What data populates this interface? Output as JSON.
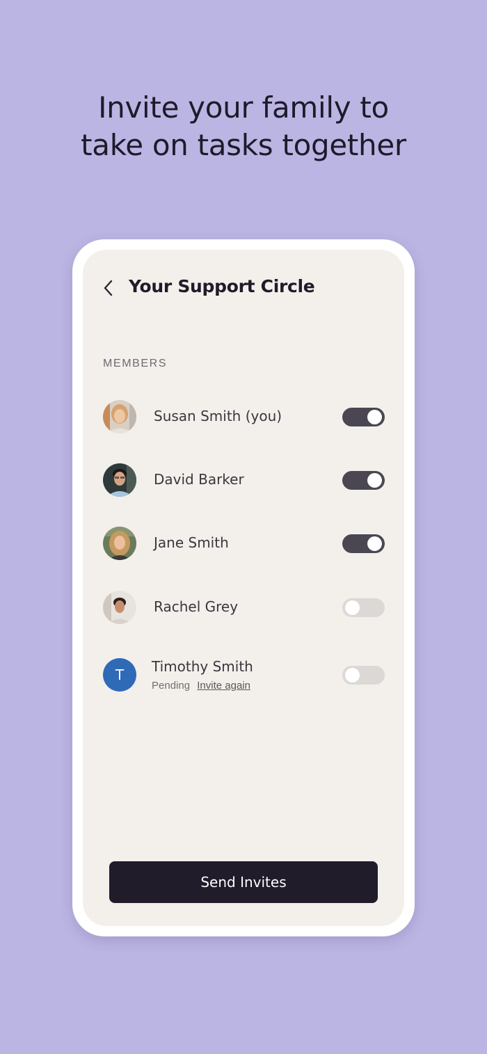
{
  "headline": {
    "line1": "Invite your family to",
    "line2": "take on tasks together"
  },
  "screen": {
    "title": "Your Support Circle",
    "back_icon": "chevron-left-icon"
  },
  "members_section": {
    "label": "MEMBERS",
    "members": [
      {
        "name": "Susan Smith (you)",
        "avatar": "photo",
        "toggle_on": true
      },
      {
        "name": "David Barker",
        "avatar": "photo",
        "toggle_on": true
      },
      {
        "name": "Jane Smith",
        "avatar": "photo",
        "toggle_on": true
      },
      {
        "name": "Rachel Grey",
        "avatar": "photo",
        "toggle_on": false
      },
      {
        "name": "Timothy Smith",
        "avatar_initial": "T",
        "status": "Pending",
        "action": "Invite again",
        "toggle_on": false
      }
    ]
  },
  "send_button": {
    "label": "Send Invites"
  },
  "colors": {
    "background": "#bbb5e3",
    "screen": "#f3efea",
    "toggle_on": "#4a4652",
    "toggle_off": "#dcd8d5",
    "primary_button": "#201c2a",
    "initial_avatar": "#2f6ab7"
  }
}
